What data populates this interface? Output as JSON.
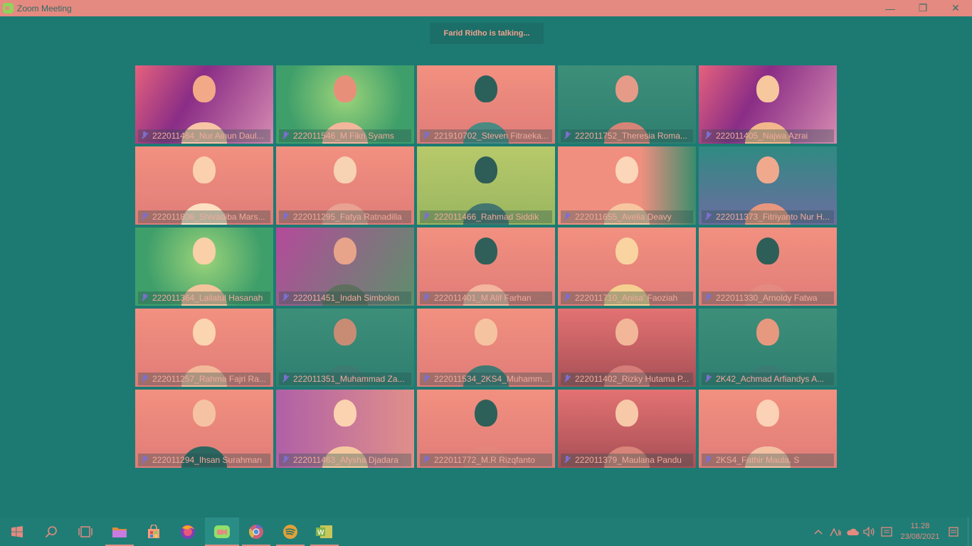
{
  "window": {
    "title": "Zoom Meeting",
    "controls": {
      "minimize": "—",
      "restore": "❐",
      "close": "✕"
    }
  },
  "meeting": {
    "talking_banner": "Farid Ridho is talking..."
  },
  "participants": [
    "222011464_Nur Ainun Daul...",
    "222011546_M Fikri Syams",
    "221910702_Steven Fitraeka...",
    "222011752_Theresia Roma...",
    "222011405_Najwa Azrai",
    "222011806_Shivadiba Mars...",
    "222011295_Fatya Ratnadilla",
    "222011466_Rahmad Siddik",
    "222011655_Avelia Deavy",
    "222011373_Fitriyanto Nur H...",
    "222011364_Lailatul Hasanah",
    "222011451_Indah Simbolon",
    "222011401_M Alif Farhan",
    "222011710_Anisa' Faoziah",
    "222011330_Arnoldy Fatwa",
    "222011257_Rahma Fajri Ra...",
    "222011351_Muhammad Za...",
    "222011534_2KS4_Muhamm...",
    "222011402_Rizky Hutama P...",
    "2K42_Achmad Arfiandys A...",
    "222011294_Ihsan Surahman",
    "222011463_Afysha Djadara",
    "222011772_M.R Rizqfanto",
    "222011379_Maulana Pandu",
    "2KS4_Fathir Maula. S"
  ],
  "taskbar": {
    "apps": [
      "start",
      "search",
      "task-view",
      "file-explorer",
      "microsoft-store",
      "firefox",
      "zoom",
      "chrome",
      "spotify",
      "word"
    ],
    "clock_time": "11.28",
    "clock_date": "23/08/2021"
  }
}
